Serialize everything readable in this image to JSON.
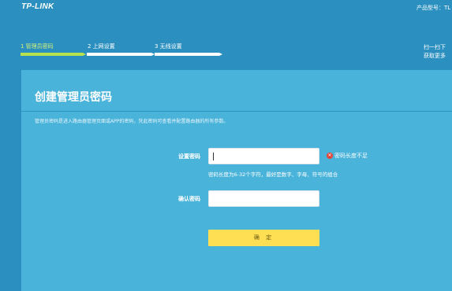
{
  "header": {
    "logo": "TP-LINK",
    "product_label": "产品型号：TL"
  },
  "steps": [
    {
      "label": "1 管理员密码",
      "state": "active"
    },
    {
      "label": "2 上网设置",
      "state": "inactive"
    },
    {
      "label": "3 无线设置",
      "state": "inactive"
    }
  ],
  "scan_hint": {
    "line1": "扫一扫下",
    "line2": "获取更多"
  },
  "panel": {
    "title": "创建管理员密码",
    "description": "管理员密码是进入路由器管理页面或APP的密码，凭此密码可查看并配置路由器的所有参数。"
  },
  "form": {
    "password_label": "设置密码",
    "password_value": "",
    "password_error": "密码长度不足",
    "password_hint": "密码长度为6-32个字符，最好是数字、字母、符号的组合",
    "confirm_label": "确认密码",
    "confirm_value": "",
    "submit_label": "确 定"
  },
  "colors": {
    "background": "#2b90bf",
    "panel": "#4ab3da",
    "active_step": "#b7e24d",
    "button": "#fedf53",
    "error_icon": "#e2463a"
  }
}
